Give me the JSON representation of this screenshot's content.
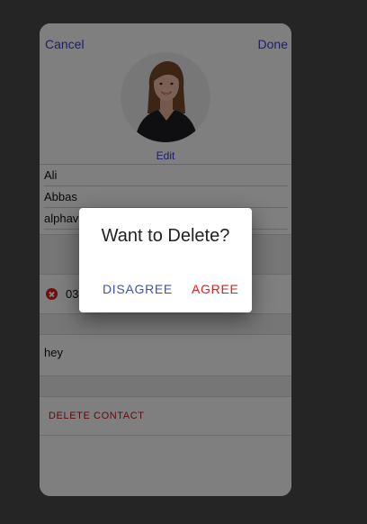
{
  "header": {
    "cancel_label": "Cancel",
    "done_label": "Done"
  },
  "avatar": {
    "edit_label": "Edit"
  },
  "fields": {
    "first_name": "Ali",
    "last_name": "Abbas",
    "company": "alphav"
  },
  "phone": {
    "number": "03"
  },
  "note": {
    "text": "hey"
  },
  "actions": {
    "delete_contact_label": "DELETE CONTACT"
  },
  "dialog": {
    "title": "Want to Delete?",
    "disagree_label": "DISAGREE",
    "agree_label": "AGREE"
  },
  "colors": {
    "link": "#3b3bd6",
    "disagree": "#3f51b5",
    "agree": "#e01c1c",
    "delete": "#b71c1c",
    "page_background": "#252525"
  }
}
